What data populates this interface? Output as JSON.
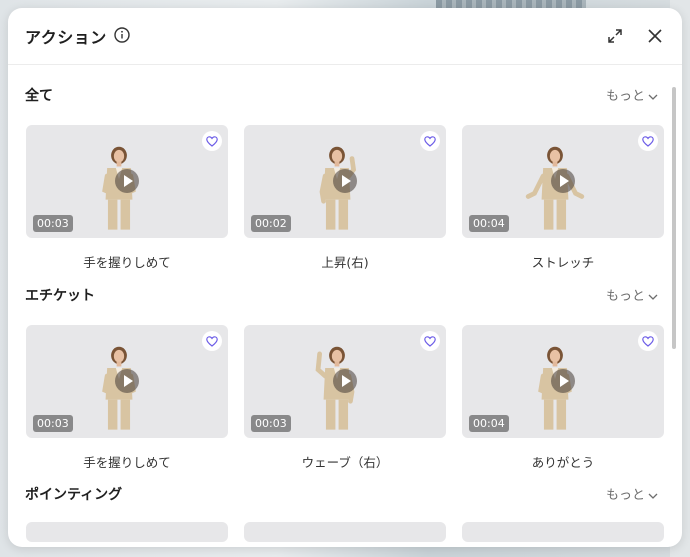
{
  "panel": {
    "title": "アクション",
    "more_label": "もっと"
  },
  "sections": [
    {
      "title": "全て",
      "items": [
        {
          "duration": "00:03",
          "name": "手を握りしめて"
        },
        {
          "duration": "00:02",
          "name": "上昇(右)"
        },
        {
          "duration": "00:04",
          "name": "ストレッチ"
        }
      ]
    },
    {
      "title": "エチケット",
      "items": [
        {
          "duration": "00:03",
          "name": "手を握りしめて"
        },
        {
          "duration": "00:03",
          "name": "ウェーブ（右）"
        },
        {
          "duration": "00:04",
          "name": "ありがとう"
        }
      ]
    },
    {
      "title": "ポインティング",
      "items": []
    }
  ],
  "colors": {
    "heart": "#6c5ce7",
    "thumb_bg": "#e7e7e9",
    "suit": "#d8c4a2"
  }
}
